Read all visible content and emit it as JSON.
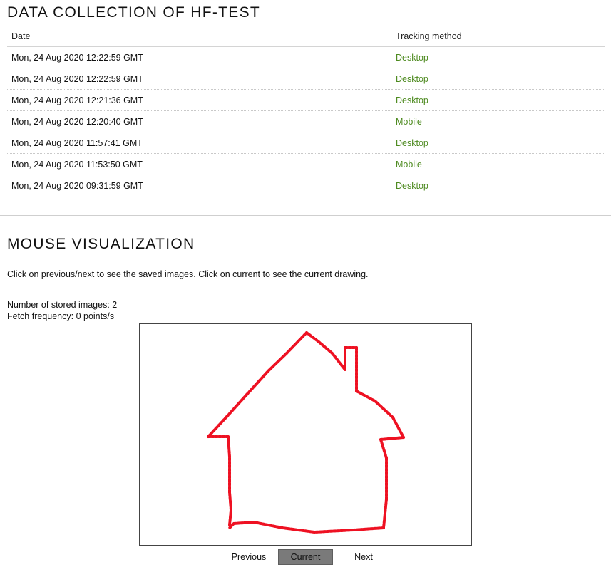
{
  "data_collection": {
    "title": "DATA COLLECTION OF HF-TEST",
    "columns": [
      "Date",
      "Tracking method"
    ],
    "rows": [
      {
        "date": "Mon, 24 Aug 2020 12:22:59 GMT",
        "method": "Desktop"
      },
      {
        "date": "Mon, 24 Aug 2020 12:22:59 GMT",
        "method": "Desktop"
      },
      {
        "date": "Mon, 24 Aug 2020 12:21:36 GMT",
        "method": "Desktop"
      },
      {
        "date": "Mon, 24 Aug 2020 12:20:40 GMT",
        "method": "Mobile"
      },
      {
        "date": "Mon, 24 Aug 2020 11:57:41 GMT",
        "method": "Desktop"
      },
      {
        "date": "Mon, 24 Aug 2020 11:53:50 GMT",
        "method": "Mobile"
      },
      {
        "date": "Mon, 24 Aug 2020 09:31:59 GMT",
        "method": "Desktop"
      }
    ]
  },
  "mouse_visualization": {
    "title": "MOUSE VISUALIZATION",
    "description": "Click on previous/next to see the saved images. Click on current to see the current drawing.",
    "stored_images": "Number of stored images: 2",
    "fetch_frequency": "Fetch frequency: 0 points/s",
    "stroke_color": "#ee1122",
    "buttons": {
      "previous": "Previous",
      "current": "Current",
      "next": "Next"
    }
  },
  "colors": {
    "method_text": "#4d8a1f",
    "current_button_bg": "#7a7a7a"
  }
}
